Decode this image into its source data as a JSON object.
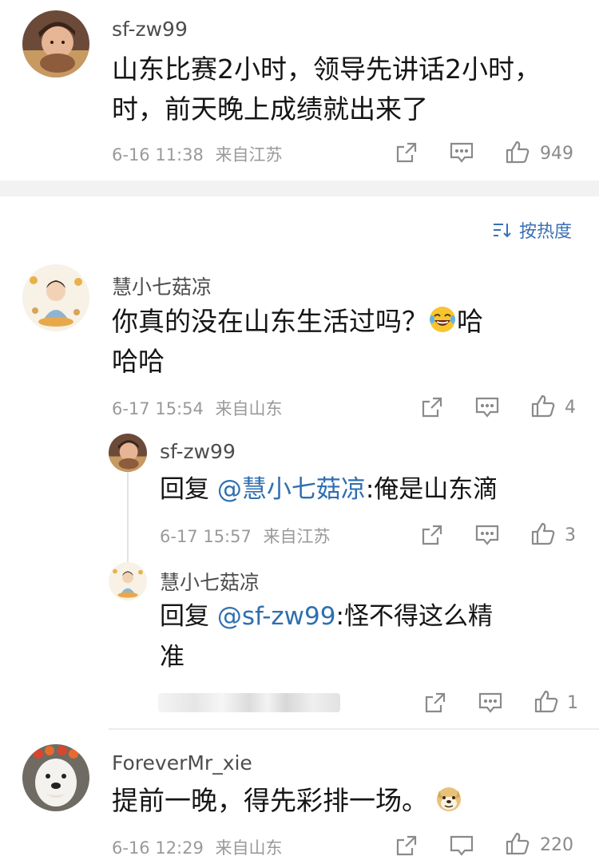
{
  "comments": [
    {
      "user": "sf-zw99",
      "text": "山东比赛2小时，领导先讲话2小时，前天晚上成绩就出来了",
      "line1": "山东比赛2小时，领导先讲话2小时，",
      "line2": "时，前天晚上成绩就出来了",
      "time": "6-16 11:38",
      "location": "来自江苏",
      "likes": "949"
    }
  ],
  "sort_label": "按热度",
  "thread": {
    "user": "慧小七菇凉",
    "line1": "你真的没在山东生活过吗？",
    "line1_tail": "哈",
    "line2": "哈哈",
    "emoji": "laughing-tears",
    "time": "6-17 15:54",
    "location": "来自山东",
    "likes": "4",
    "replies": [
      {
        "user": "sf-zw99",
        "prefix": "回复 ",
        "mention": "@慧小七菇凉",
        "text": ":俺是山东滴",
        "time": "6-17 15:57",
        "location": "来自江苏",
        "likes": "3"
      },
      {
        "user": "慧小七菇凉",
        "prefix": "回复 ",
        "mention": "@sf-zw99",
        "text_line1": ":怪不得这么精",
        "text_line2": "准",
        "likes": "1"
      }
    ]
  },
  "last_comment": {
    "user": "ForeverMr_xie",
    "text": "提前一晚，得先彩排一场。",
    "emoji": "doge",
    "time": "6-16 12:29",
    "location": "来自山东",
    "likes": "220"
  },
  "colors": {
    "mention": "#2f6fb0",
    "meta": "#9a9a9a",
    "sort": "#3a6fb8",
    "band": "#f2f2f2"
  }
}
